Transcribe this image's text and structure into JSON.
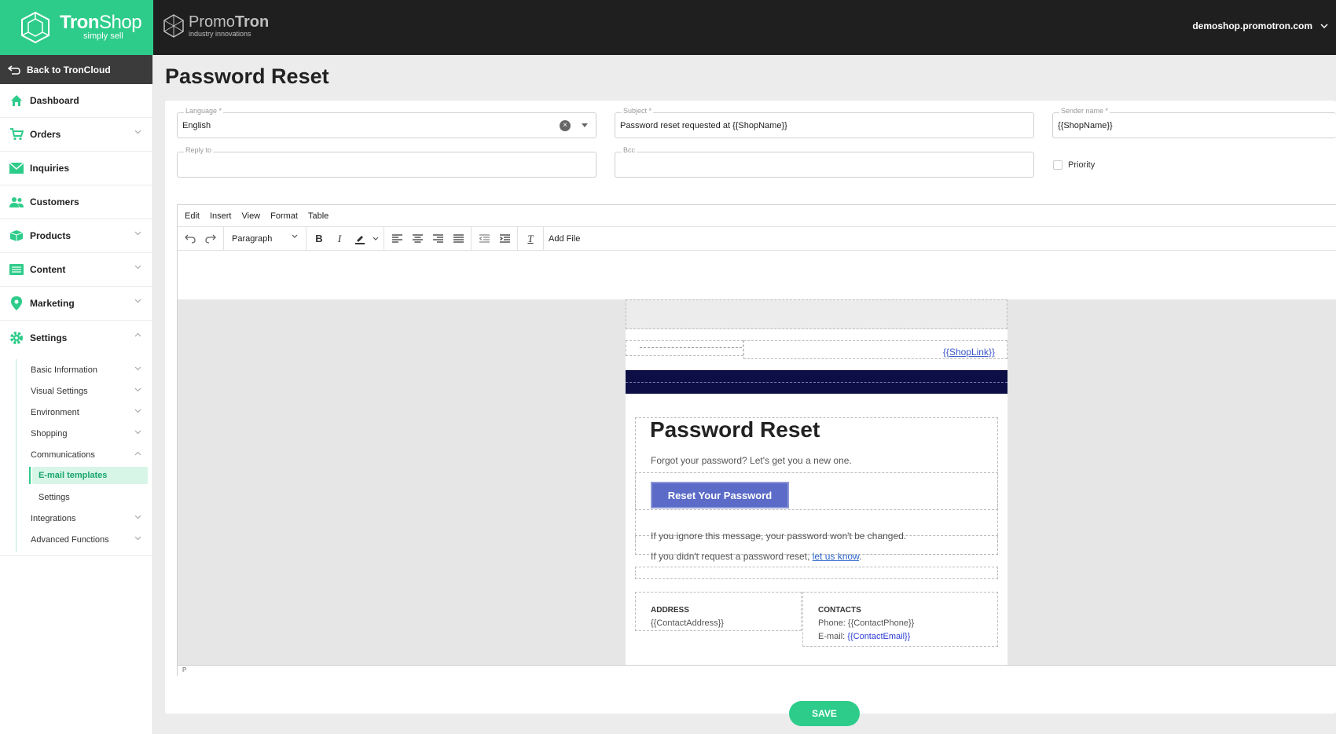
{
  "brand": {
    "name_bold": "Tron",
    "name_rest": "Shop",
    "tagline": "simply sell"
  },
  "promo": {
    "name_light": "Promo",
    "name_bold": "Tron",
    "tagline": "industry innovations"
  },
  "header": {
    "domain": "demoshop.promotron.com"
  },
  "sidebar": {
    "back_label": "Back to TronCloud",
    "items": [
      {
        "label": "Dashboard",
        "icon": "home-icon"
      },
      {
        "label": "Orders",
        "icon": "cart-icon"
      },
      {
        "label": "Inquiries",
        "icon": "envelope-icon"
      },
      {
        "label": "Customers",
        "icon": "users-icon"
      },
      {
        "label": "Products",
        "icon": "box-icon"
      },
      {
        "label": "Content",
        "icon": "list-icon"
      },
      {
        "label": "Marketing",
        "icon": "pin-icon"
      },
      {
        "label": "Settings",
        "icon": "gear-icon"
      }
    ],
    "settings_sub": [
      "Basic Information",
      "Visual Settings",
      "Environment",
      "Shopping",
      "Communications",
      "E-mail templates",
      "Settings",
      "Integrations",
      "Advanced Functions"
    ]
  },
  "page": {
    "title": "Password Reset"
  },
  "form": {
    "language": {
      "label": "Language *",
      "value": "English"
    },
    "subject": {
      "label": "Subject *",
      "value": "Password reset requested at {{ShopName}}"
    },
    "sender": {
      "label": "Sender name *",
      "value": "{{ShopName}}"
    },
    "reply_to": {
      "label": "Reply to",
      "value": ""
    },
    "bcc": {
      "label": "Bcc",
      "value": ""
    },
    "priority_label": "Priority"
  },
  "editor": {
    "menu": [
      "Edit",
      "Insert",
      "View",
      "Format",
      "Table"
    ],
    "block_format": "Paragraph",
    "add_file": "Add File",
    "status": "P"
  },
  "email": {
    "shop_link": "{{ShopLink}}",
    "title": "Password Reset",
    "subtitle": "Forgot your password? Let's get you a new one.",
    "button": "Reset Your Password",
    "text1": "If you ignore this message, your password won't be changed.",
    "text2_prefix": "If you didn't request a password reset, ",
    "text2_link": "let us know",
    "text2_suffix": ".",
    "address_title": "ADDRESS",
    "address_value": "{{ContactAddress}}",
    "contacts_title": "CONTACTS",
    "phone_prefix": "Phone: ",
    "phone_value": "{{ContactPhone}}",
    "email_prefix": "E-mail: ",
    "email_value": "{{ContactEmail}}"
  },
  "save_label": "SAVE",
  "colors": {
    "brand_green": "#2ecc8a",
    "topbar": "#1f1f1f",
    "email_banner": "#0c0e45",
    "email_button": "#5b6bc7"
  }
}
